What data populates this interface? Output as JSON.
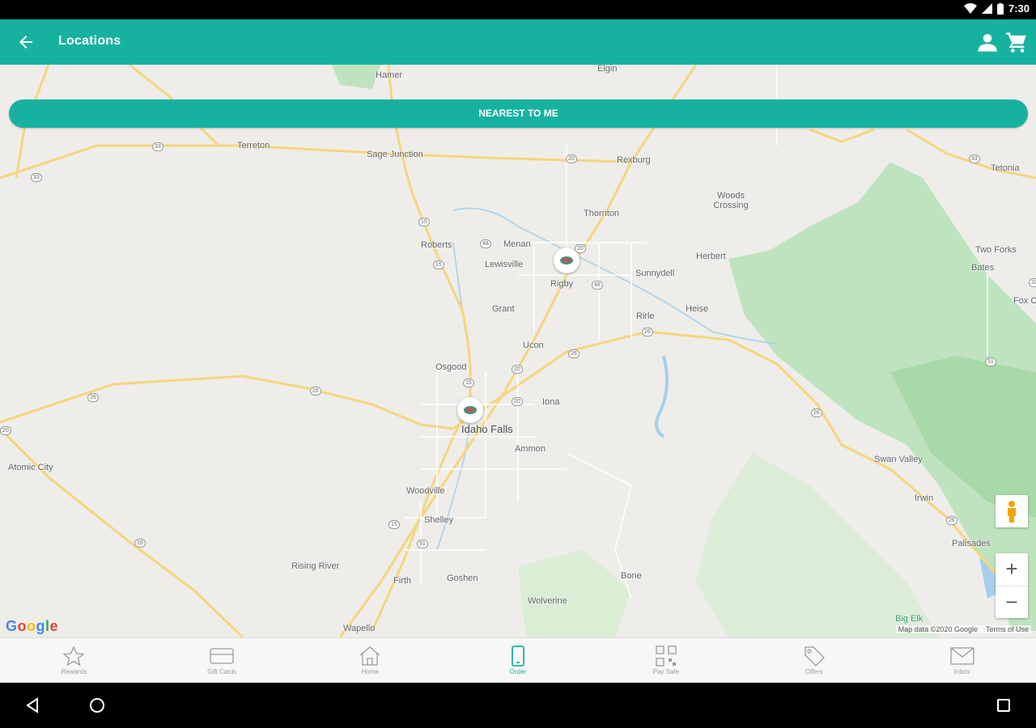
{
  "status_bar": {
    "time": "7:30",
    "icons": [
      "wifi-icon",
      "signal-icon",
      "battery-icon"
    ]
  },
  "app_bar": {
    "title": "Locations",
    "icons": [
      "back-arrow-icon",
      "account-icon",
      "cart-icon"
    ]
  },
  "map": {
    "nearest_label": "NEAREST TO ME",
    "places": [
      "Hamer",
      "Terreton",
      "Sage Junction",
      "Rexburg",
      "Tetonia",
      "Thornton",
      "Woods Crossing",
      "Roberts",
      "Menan",
      "Lewisville",
      "Rigby",
      "Sunnydell",
      "Herbert",
      "Two Forks",
      "Bates",
      "Grant",
      "Rirle",
      "Heise",
      "Ucon",
      "Osgood",
      "Iona",
      "Idaho Falls",
      "Ammon",
      "Atomic City",
      "Swan Valley",
      "Woodville",
      "Irwin",
      "Shelley",
      "Palisades",
      "Rising River",
      "Firth",
      "Goshen",
      "Bone",
      "Wolverine",
      "Wapello",
      "Big Elk",
      "Fox Cr",
      "Elgin"
    ],
    "shields": [
      "33",
      "33",
      "33",
      "20",
      "20",
      "15",
      "48",
      "15",
      "20",
      "48",
      "26",
      "26",
      "15",
      "20",
      "26",
      "26",
      "20",
      "26",
      "15",
      "26",
      "91",
      "26",
      "31",
      "33"
    ],
    "attribution": "Map data ©2020 Google",
    "terms": "Terms of Use",
    "logo": "Google",
    "zoom_in": "+",
    "zoom_out": "−",
    "icons": [
      "pegman-icon",
      "location-marker-icon"
    ]
  },
  "bottom_nav": {
    "items": [
      {
        "label": "Rewards",
        "icon": "star-icon"
      },
      {
        "label": "Gift Cards",
        "icon": "gift-card-icon"
      },
      {
        "label": "Home",
        "icon": "home-icon"
      },
      {
        "label": "Order",
        "icon": "phone-icon",
        "active": true
      },
      {
        "label": "Pay Safe",
        "icon": "qr-code-icon"
      },
      {
        "label": "Offers",
        "icon": "tag-icon"
      },
      {
        "label": "Inbox",
        "icon": "mail-icon"
      }
    ]
  },
  "system_nav": {
    "icons": [
      "back-triangle-icon",
      "home-circle-icon",
      "recents-square-icon"
    ]
  },
  "colors": {
    "accent": "#17b29f",
    "map_bg": "#eeede9",
    "park": "#a8d9a8",
    "highway": "#f5d67c",
    "water": "#a6d0ea"
  }
}
